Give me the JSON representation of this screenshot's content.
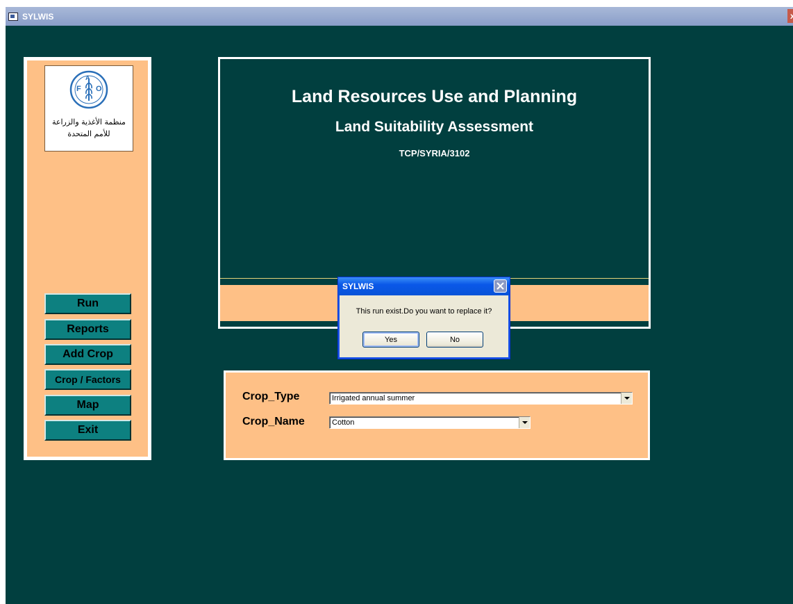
{
  "window": {
    "title": "SYLWIS",
    "close_glyph": "x"
  },
  "logo": {
    "arabic_line1": "منظمة الأغذية والزراعة",
    "arabic_line2": "للأمم المتحدة",
    "fao_text": "FAO",
    "fiat_text": "FIAT PANIS"
  },
  "nav": {
    "run": "Run",
    "reports": "Reports",
    "add_crop": "Add Crop",
    "crop_factors": "Crop / Factors",
    "map": "Map",
    "exit": "Exit"
  },
  "header": {
    "title": "Land Resources Use and  Planning",
    "subtitle": "Land Suitability Assessment",
    "project": "TCP/SYRIA/3102"
  },
  "crop": {
    "type_label": "Crop_Type",
    "type_value": "Irrigated annual summer",
    "name_label": "Crop_Name",
    "name_value": "Cotton"
  },
  "dialog": {
    "title": "SYLWIS",
    "message": "This run exist.Do you want to replace it?",
    "yes": "Yes",
    "no": "No"
  },
  "colors": {
    "background": "#013f3f",
    "panel": "#fec086",
    "button": "#0d8080"
  }
}
